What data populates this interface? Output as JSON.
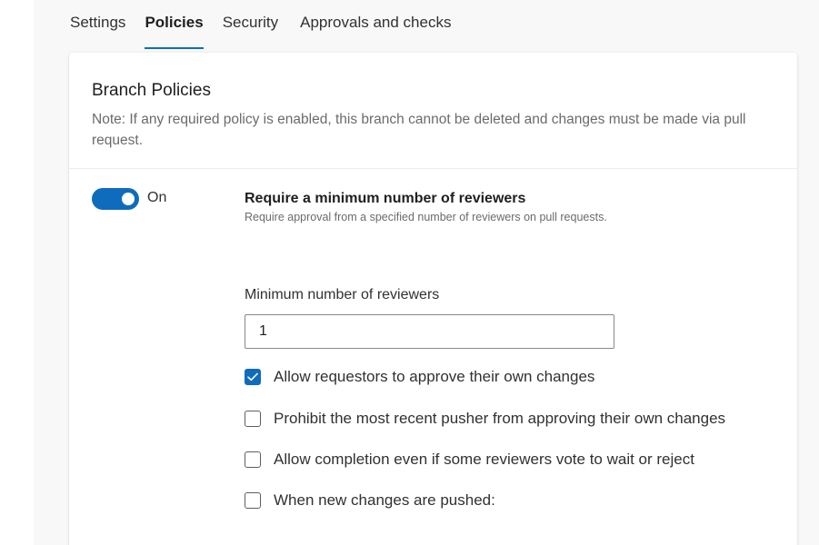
{
  "tabs": [
    {
      "label": "Settings",
      "active": false
    },
    {
      "label": "Policies",
      "active": true
    },
    {
      "label": "Security",
      "active": false
    },
    {
      "label": "Approvals and checks",
      "active": false
    }
  ],
  "colors": {
    "accent": "#0f6cbd",
    "text_primary": "#201f1e",
    "text_secondary": "#6b6b6b"
  },
  "branch_policies": {
    "title": "Branch Policies",
    "note": "Note: If any required policy is enabled, this branch cannot be deleted and changes must be made via pull request."
  },
  "min_reviewers_policy": {
    "toggle_state": "On",
    "enabled": true,
    "title": "Require a minimum number of reviewers",
    "description": "Require approval from a specified number of reviewers on pull requests.",
    "field_label": "Minimum number of reviewers",
    "field_value": "1",
    "options": [
      {
        "label": "Allow requestors to approve their own changes",
        "checked": true
      },
      {
        "label": "Prohibit the most recent pusher from approving their own changes",
        "checked": false
      },
      {
        "label": "Allow completion even if some reviewers vote to wait or reject",
        "checked": false
      },
      {
        "label": "When new changes are pushed:",
        "checked": false
      }
    ]
  }
}
